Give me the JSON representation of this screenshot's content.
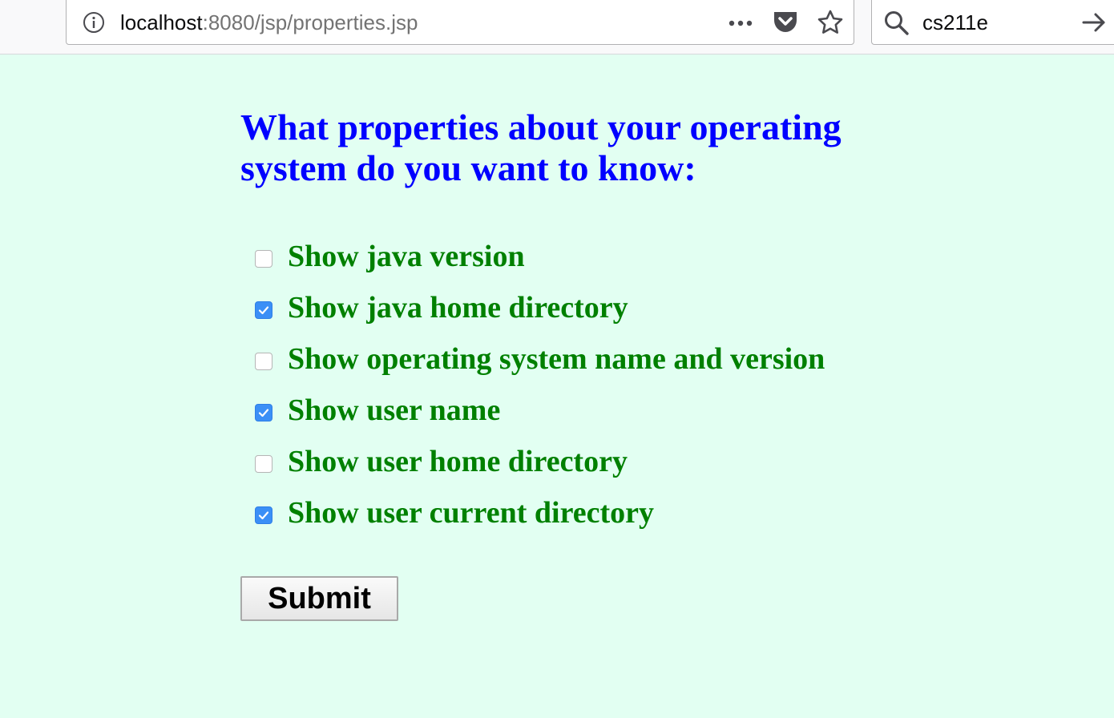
{
  "browser": {
    "url_host": "localhost",
    "url_path": ":8080/jsp/properties.jsp",
    "search_query": "cs211e"
  },
  "page": {
    "background_color": "#e2fff2",
    "heading": "What properties about your operating system do you want to know:",
    "heading_color": "#0000ff",
    "label_color": "#008000",
    "options": [
      {
        "label": "Show java version",
        "checked": false
      },
      {
        "label": "Show java home directory",
        "checked": true
      },
      {
        "label": "Show operating system name and version",
        "checked": false
      },
      {
        "label": "Show user name",
        "checked": true
      },
      {
        "label": "Show user home directory",
        "checked": false
      },
      {
        "label": "Show user current directory",
        "checked": true
      }
    ],
    "submit_label": "Submit"
  },
  "icons": {
    "site_info": "info-icon",
    "page_actions": "more-horizontal-icon",
    "pocket": "pocket-icon",
    "bookmark": "star-icon",
    "search": "search-icon",
    "go": "arrow-right-icon"
  }
}
